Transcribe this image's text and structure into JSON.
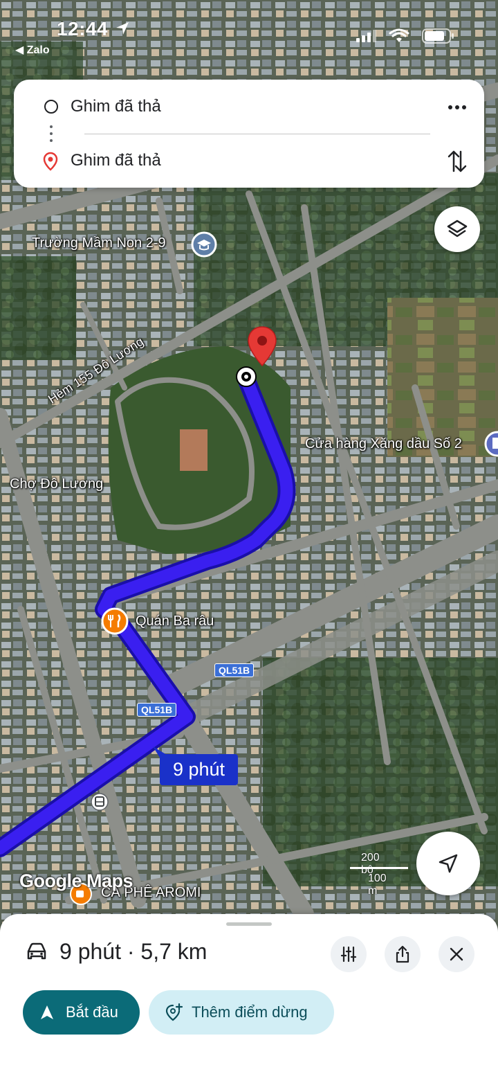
{
  "status_bar": {
    "time": "12:44",
    "back_app": "Zalo"
  },
  "route": {
    "origin": "Ghim đã thả",
    "destination": "Ghim đã thả"
  },
  "map": {
    "labels": {
      "school": "Trường Mầm Non 2-9",
      "alley": "Hẻm 155 Đô Lương",
      "gas_station": "Cửa hàng Xăng dầu Số 2",
      "market": "Chợ Đô Lương",
      "restaurant": "Quán Ba râu",
      "cafe": "CÀ PHÊ AROMI"
    },
    "road_shields": [
      "QL51B",
      "QL51B"
    ],
    "route_time_badge": "9 phút",
    "scale_imperial": "200 bộ",
    "scale_metric": "100 m",
    "logo": "Google Maps",
    "route_color": "#3a1ff0"
  },
  "sheet": {
    "summary": "9 phút · 5,7 km",
    "start_label": "Bắt đầu",
    "add_stop_label": "Thêm điểm dừng"
  },
  "colors": {
    "start_button": "#0b6b78",
    "add_stop_button": "#d2eef5",
    "destination_pin": "#e53935",
    "time_badge": "#1a31c9"
  }
}
